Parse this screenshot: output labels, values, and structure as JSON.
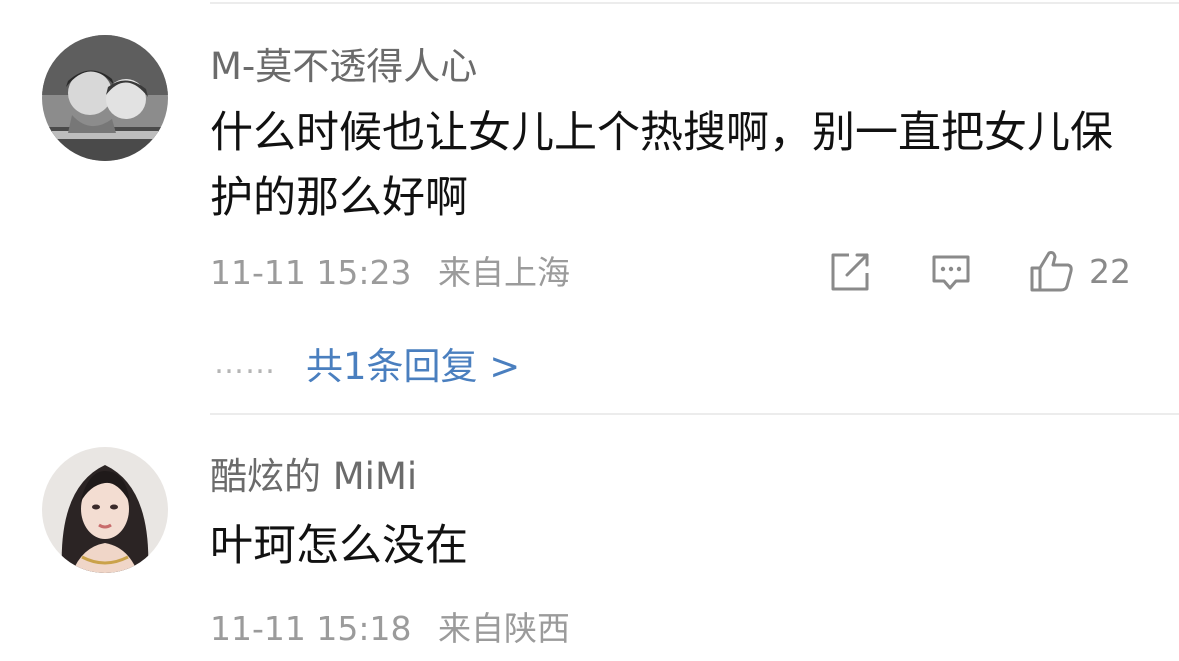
{
  "comments": [
    {
      "username": "M-莫不透得人心",
      "text": "什么时候也让女儿上个热搜啊，别一直把女儿保护的那么好啊",
      "date": "11-11 15:23",
      "location": "来自上海",
      "like_count": "22",
      "replies_label": "共1条回复 >",
      "replies_dots": "……"
    },
    {
      "username": "酷炫的 MiMi",
      "text": "叶珂怎么没在",
      "date": "11-11 15:18",
      "location": "来自陕西"
    }
  ],
  "icons": {
    "share": "share-icon",
    "comment": "comment-icon",
    "like": "thumbs-up-icon"
  },
  "colors": {
    "username": "#6b6b6b",
    "text": "#111111",
    "meta": "#9b9b9b",
    "link": "#4a7fbf",
    "divider": "#ececec"
  }
}
